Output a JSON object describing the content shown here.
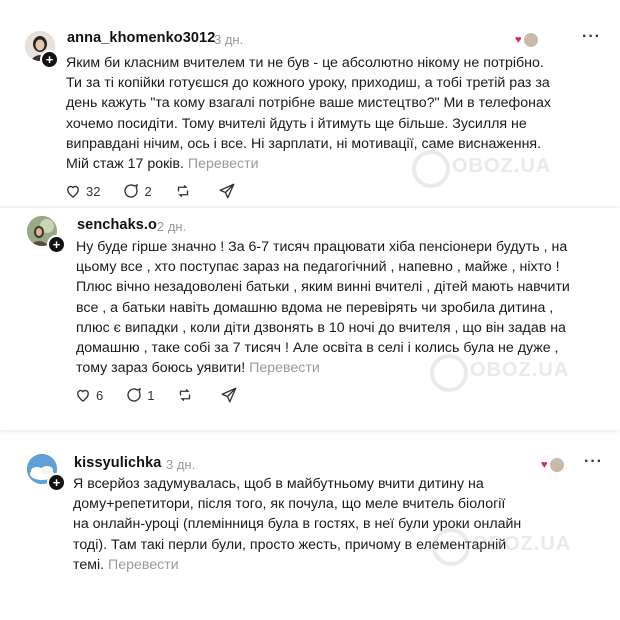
{
  "comments": [
    {
      "username": "anna_khomenko3012",
      "time": "3 дн.",
      "text": "Яким би класним вчителем ти не був - це абсолютно нікому не потрібно.\nТи за ті копійки готуєшся до кожного уроку, приходиш, а тобі третій раз за\nдень кажуть \"та кому взагалі потрібне ваше мистецтво?\" Ми в телефонах\nхочемо посидіти. Тому вчителі йдуть і йтимуть ще більше. Зусилля не\nвиправдані нічим, ось і все. Ні зарплати, ні мотивації, саме виснаження.\nМій стаж 17 років.",
      "translate": "Перевести",
      "likes": "32",
      "replies": "2",
      "reposts": "",
      "colors": {
        "avatar_bg": "#d9d3cc"
      }
    },
    {
      "username": "senchaks.o",
      "time": "2 дн.",
      "text": "Ну буде гірше значно ! За 6-7 тисяч працювати хіба пенсіонери будуть , на\nцьому все , хто поступає зараз на педагогічний , напевно , майже , ніхто !\nПлюс вічно незадоволені батьки , яким винні вчителі , дітей мають навчити\nвсе , а батьки навіть домашню вдома не перевірять чи зробила дитина ,\nплюс є випадки , коли діти дзвонять в 10 ночі до вчителя , що він задав на\nдомашню , таке собі за 7 тисяч ! Але освіта в селі і колись була не дуже ,\nтому зараз боюсь уявити!",
      "translate": "Перевести",
      "likes": "6",
      "replies": "1",
      "reposts": "",
      "colors": {
        "avatar_bg": "#8a9a7a"
      }
    },
    {
      "username": "kissyulichka",
      "time": "3 дн.",
      "text": "Я всерйоз задумувалась, щоб в майбутньому вчити дитину на\nдому+репетитори, після того, як почула, що меле вчитель біології\nна онлайн-уроці (племінниця була в гостях, в неї були уроки онлайн\nтоді). Там такі перли були, просто жесть, причому в елементарній\nтемі.",
      "translate": "Перевести",
      "colors": {
        "avatar_bg": "#6aa8d8"
      }
    }
  ],
  "watermark": "OBOZ.UA",
  "icons": {
    "like": "heart-icon",
    "reply": "comment-icon",
    "repost": "repost-icon",
    "share": "share-icon",
    "more": "more-icon"
  },
  "colors": {
    "heart_red": "#e0245e",
    "muted": "#999999"
  }
}
